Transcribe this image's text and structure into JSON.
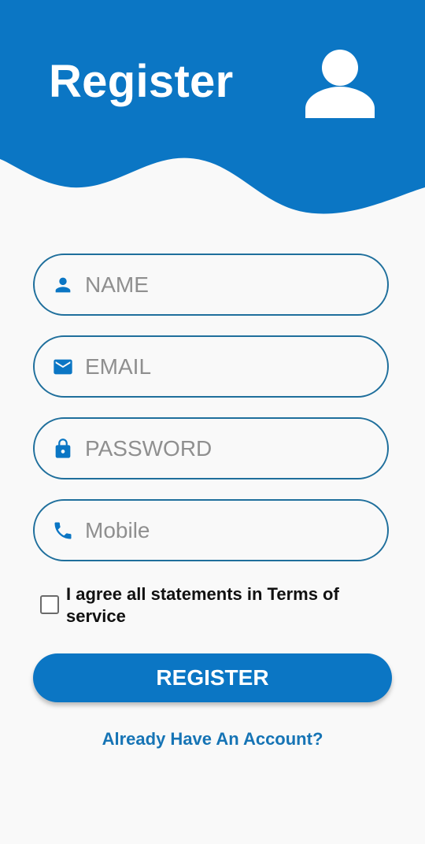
{
  "header": {
    "title": "Register",
    "icon": "person-avatar-icon"
  },
  "form": {
    "name": {
      "placeholder": "NAME",
      "icon": "person-icon",
      "value": ""
    },
    "email": {
      "placeholder": "EMAIL",
      "icon": "mail-icon",
      "value": ""
    },
    "password": {
      "placeholder": "PASSWORD",
      "icon": "lock-icon",
      "value": ""
    },
    "mobile": {
      "placeholder": "Mobile",
      "icon": "phone-icon",
      "value": ""
    },
    "terms": {
      "label": "I agree all statements in Terms of service",
      "checked": false
    },
    "submit_label": "REGISTER",
    "login_link": "Already Have An Account?"
  },
  "colors": {
    "primary": "#0b76c4",
    "field_border": "#1f6f9c",
    "background": "#f9f9f9",
    "link": "#1674b5"
  }
}
